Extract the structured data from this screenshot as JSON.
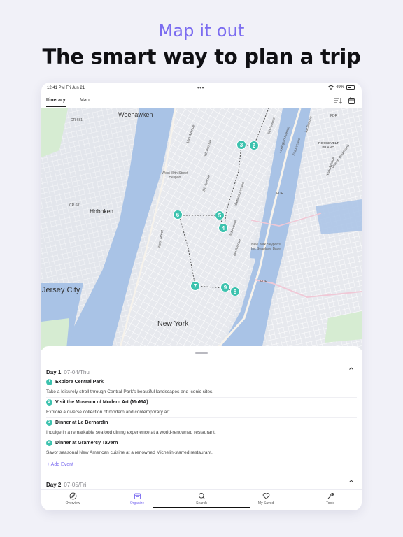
{
  "headline": {
    "subtitle": "Map it out",
    "title": "The smart way to plan a trip"
  },
  "status_bar": {
    "time": "12:41 PM   Fri Jun 21",
    "dots": "•••",
    "battery": "49%"
  },
  "tabs": [
    {
      "label": "Itinerary",
      "active": true
    },
    {
      "label": "Map",
      "active": false
    }
  ],
  "map": {
    "labels": {
      "weehawken": "Weehawken",
      "hoboken": "Hoboken",
      "jersey_city": "Jersey City",
      "new_york": "New York",
      "roosevelt_island": "ROOSEVELT ISLAND",
      "heliport": "West 30th Street Heliport",
      "seaplane": "New York Skyports Inc Seaplane Base",
      "cr681": "CR 681",
      "fdr": "FDR",
      "lexington": "Lexington Avenue",
      "fifth_ave": "5th Avenue",
      "madison": "Madison Avenue",
      "second_ave": "2nd Avenue",
      "first_ave": "1st Avenue",
      "ninth_ave": "9th Avenue",
      "eighth_ave": "8th Avenue",
      "tenth_ave": "10th Avenue",
      "sixth_ave": "6th Avenue",
      "third_ave": "3rd Avenue",
      "west_street": "West Street",
      "york_ave": "York Avenue",
      "vernon": "Vernon Boulevard"
    },
    "pins": [
      "2",
      "3",
      "4",
      "5",
      "6",
      "7",
      "8",
      "9"
    ],
    "route_color": "#555555",
    "pin_color": "#3cc2ae"
  },
  "itinerary": {
    "day1": {
      "title": "Day 1",
      "date": "07-04/Thu"
    },
    "events": [
      {
        "num": "1",
        "title": "Explore Central Park",
        "desc": "Take a leisurely stroll through Central Park's beautiful landscapes and iconic sites."
      },
      {
        "num": "2",
        "title": "Visit the Museum of Modern Art (MoMA)",
        "desc": "Explore a diverse collection of modern and contemporary art."
      },
      {
        "num": "3",
        "title": "Dinner at Le Bernardin",
        "desc": "Indulge in a remarkable seafood dining experience at a world-renowned restaurant."
      },
      {
        "num": "4",
        "title": "Dinner at Gramercy Tavern",
        "desc": "Savor seasonal New American cuisine at a renowned Michelin-starred restaurant."
      }
    ],
    "add_event": "+ Add Event",
    "day2": {
      "title": "Day 2",
      "date": "07-05/Fri"
    }
  },
  "tabbar": [
    {
      "label": "Overview",
      "icon": "compass-icon"
    },
    {
      "label": "Organize",
      "icon": "calendar-icon",
      "active": true
    },
    {
      "label": "Search",
      "icon": "search-icon"
    },
    {
      "label": "My Saved",
      "icon": "heart-icon"
    },
    {
      "label": "Tools",
      "icon": "wrench-icon"
    }
  ],
  "colors": {
    "accent": "#7b6cf0",
    "pin": "#3cc2ae",
    "water": "#a9c3e6",
    "land": "#e3e6ec",
    "park": "#d6ecd2"
  }
}
